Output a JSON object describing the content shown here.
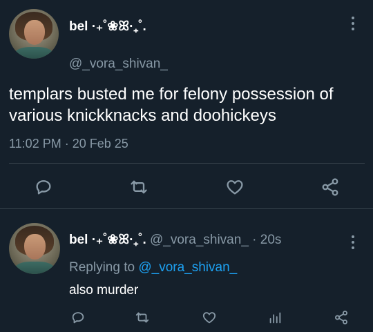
{
  "main_tweet": {
    "display_name": "bel ·₊˚❀ꕤ·₊˚.",
    "handle": "@_vora_shivan_",
    "text": "templars busted me for felony possession of various knickknacks and doohickeys",
    "timestamp": "11:02 PM · 20 Feb 25",
    "actions": [
      "reply-icon",
      "retweet-icon",
      "like-icon",
      "share-icon"
    ]
  },
  "reply_tweet": {
    "display_name": "bel ·₊˚❀ꕤ·₊˚.",
    "handle": "@_vora_shivan_",
    "time": "· 20s",
    "replying_prefix": "Replying to",
    "replying_mention": "@_vora_shivan_",
    "text": "also murder",
    "actions": [
      "reply-icon",
      "retweet-icon",
      "like-icon",
      "analytics-icon",
      "share-icon"
    ]
  },
  "colors": {
    "background": "#15202b",
    "text_primary": "#ffffff",
    "text_secondary": "#8899a6",
    "accent": "#1da1f2",
    "divider": "#38444d"
  }
}
